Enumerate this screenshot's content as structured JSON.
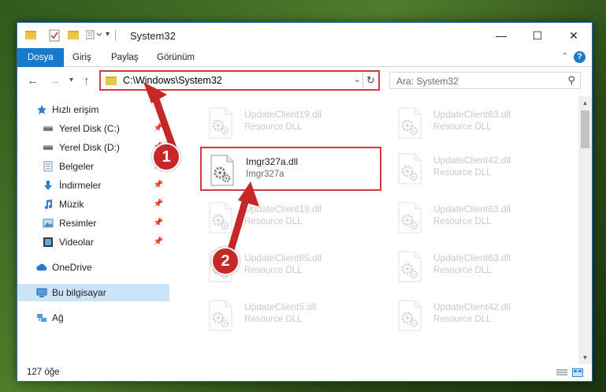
{
  "window": {
    "title": "System32",
    "controls": {
      "minimize": "—",
      "maximize": "☐",
      "close": "✕"
    }
  },
  "ribbon": {
    "tabs": [
      {
        "label": "Dosya",
        "active": true
      },
      {
        "label": "Giriş"
      },
      {
        "label": "Paylaş"
      },
      {
        "label": "Görünüm"
      }
    ],
    "help": "?"
  },
  "nav": {
    "address": "C:\\Windows\\System32",
    "search_placeholder": "Ara: System32"
  },
  "sidebar": {
    "items": [
      {
        "label": "Hızlı erişim",
        "icon": "star-icon",
        "color": "#2f7fd0"
      },
      {
        "label": "Yerel Disk (C:)",
        "icon": "drive-icon",
        "pinned": true
      },
      {
        "label": "Yerel Disk (D:)",
        "icon": "drive-icon",
        "pinned": true
      },
      {
        "label": "Belgeler",
        "icon": "documents-icon",
        "pinned": true
      },
      {
        "label": "İndirmeler",
        "icon": "download-icon",
        "pinned": true
      },
      {
        "label": "Müzik",
        "icon": "music-icon",
        "pinned": true
      },
      {
        "label": "Resimler",
        "icon": "pictures-icon",
        "pinned": true
      },
      {
        "label": "Videolar",
        "icon": "video-icon",
        "pinned": true
      },
      {
        "label": "OneDrive",
        "icon": "cloud-icon"
      },
      {
        "label": "Bu bilgisayar",
        "icon": "computer-icon",
        "selected": true
      },
      {
        "label": "Ağ",
        "icon": "network-icon"
      }
    ]
  },
  "files": [
    {
      "name": "UpdateClient19.dll",
      "desc": "Resource DLL"
    },
    {
      "name": "UpdateClient63.dll",
      "desc": "Resource DLL"
    },
    {
      "name": "Imgr327a.dll",
      "desc": "Imgr327a",
      "highlight": true
    },
    {
      "name": "UpdateClient42.dll",
      "desc": "Resource DLL"
    },
    {
      "name": "UpdateClient19.dll",
      "desc": "Resource DLL"
    },
    {
      "name": "UpdateClient63.dll",
      "desc": "Resource DLL"
    },
    {
      "name": "UpdateClient65.dll",
      "desc": "Resource DLL"
    },
    {
      "name": "UpdateClient63.dll",
      "desc": "Resource DLL"
    },
    {
      "name": "UpdateClient5.dll",
      "desc": "Resource DLL"
    },
    {
      "name": "UpdateClient42.dll",
      "desc": "Resource DLL"
    }
  ],
  "status": {
    "count": "127 öğe"
  },
  "annotations": {
    "step1": "1",
    "step2": "2",
    "accent": "#c62828"
  }
}
